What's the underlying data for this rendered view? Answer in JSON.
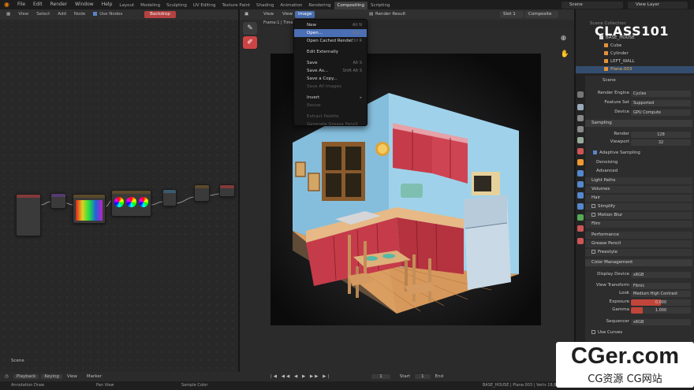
{
  "topbar": {
    "menus": [
      "File",
      "Edit",
      "Render",
      "Window",
      "Help"
    ],
    "workspaces": [
      "Layout",
      "Modeling",
      "Sculpting",
      "UV Editing",
      "Texture Paint",
      "Shading",
      "Animation",
      "Rendering",
      "Compositing",
      "Scripting"
    ],
    "active_workspace": "Compositing",
    "scene": "Scene",
    "view_layer": "View Layer"
  },
  "node_editor": {
    "menus": [
      "View",
      "Select",
      "Add",
      "Node"
    ],
    "use_nodes_label": "Use Nodes",
    "backdrop_label": "Backdrop",
    "scene_label": "Scene"
  },
  "image_editor": {
    "menus": [
      "View",
      "View",
      "Image"
    ],
    "active_menu": "Image",
    "render_result": "Render Result",
    "slot": "Slot 1",
    "composite": "Composite",
    "frame_info": "Frame:1 | Time:00:..."
  },
  "image_menu": {
    "items": [
      {
        "label": "New",
        "shortcut": "Alt N",
        "state": "normal"
      },
      {
        "label": "Open...",
        "shortcut": "Alt O",
        "state": "active"
      },
      {
        "label": "Open Cached Render",
        "shortcut": "Ctrl R",
        "state": "normal"
      },
      {
        "label": "Edit Externally",
        "shortcut": "",
        "state": "normal"
      },
      {
        "label": "Save",
        "shortcut": "Alt S",
        "state": "normal"
      },
      {
        "label": "Save As...",
        "shortcut": "Shift Alt S",
        "state": "normal"
      },
      {
        "label": "Save a Copy...",
        "shortcut": "",
        "state": "normal"
      },
      {
        "label": "Save All Images",
        "shortcut": "",
        "state": "disabled"
      },
      {
        "label": "Invert",
        "shortcut": "",
        "state": "normal"
      },
      {
        "label": "Resize",
        "shortcut": "",
        "state": "disabled"
      },
      {
        "label": "Extract Palette",
        "shortcut": "",
        "state": "disabled"
      },
      {
        "label": "Generate Grease Pencil",
        "shortcut": "",
        "state": "disabled"
      }
    ]
  },
  "outliner": {
    "rows": [
      "Scene Collection",
      "BASE_HOUSE",
      "Cube",
      "Cylinder",
      "LEFT_WALL",
      "Plane.003"
    ],
    "selected": "Plane.003"
  },
  "brand": "CLASS101",
  "properties": {
    "scene_name": "Scene",
    "render_engine": {
      "label": "Render Engine",
      "value": "Cycles"
    },
    "feature_set": {
      "label": "Feature Set",
      "value": "Supported"
    },
    "device": {
      "label": "Device",
      "value": "GPU Compute"
    },
    "sampling": "Sampling",
    "render_samples": {
      "label": "Render",
      "value": "128"
    },
    "viewport_samples": {
      "label": "Viewport",
      "value": "32"
    },
    "adaptive_sampling": "Adaptive Sampling",
    "denoising": "Denoising",
    "advanced": "Advanced",
    "light_paths": "Light Paths",
    "volumes": "Volumes",
    "hair": "Hair",
    "simplify": "Simplify",
    "motion_blur": "Motion Blur",
    "film": "Film",
    "performance": "Performance",
    "grease_pencil": "Grease Pencil",
    "freestyle": "Freestyle",
    "color_management": "Color Management",
    "display_device": {
      "label": "Display Device",
      "value": "sRGB"
    },
    "view_transform": {
      "label": "View Transform",
      "value": "Filmic"
    },
    "look": {
      "label": "Look",
      "value": "Medium High Contrast"
    },
    "exposure": {
      "label": "Exposure",
      "value": "0.000"
    },
    "gamma": {
      "label": "Gamma",
      "value": "1.000"
    },
    "sequencer": {
      "label": "Sequencer",
      "value": "sRGB"
    },
    "use_curves": "Use Curves"
  },
  "timeline": {
    "playback": "Playback",
    "keying": "Keying",
    "view": "View",
    "marker": "Marker",
    "frame": "1",
    "start_label": "Start",
    "start": "1",
    "end_label": "End"
  },
  "status": {
    "left": "Annotation Draw",
    "mid1": "Pan View",
    "mid2": "Sample Color",
    "right": "BASE_HOUSE | Plane.003 | Verts 18,641"
  },
  "watermark": {
    "line1": "CGer.com",
    "line2": "CG资源  CG网站"
  },
  "colors": {
    "accent_blue": "#4b6fb4",
    "compositing_tab": "#3d3d3d",
    "backdrop_red": "#b54242",
    "kitchen_red": "#c63b4a",
    "wall_blue": "#8fc3df",
    "floor_wood": "#d69a60"
  }
}
